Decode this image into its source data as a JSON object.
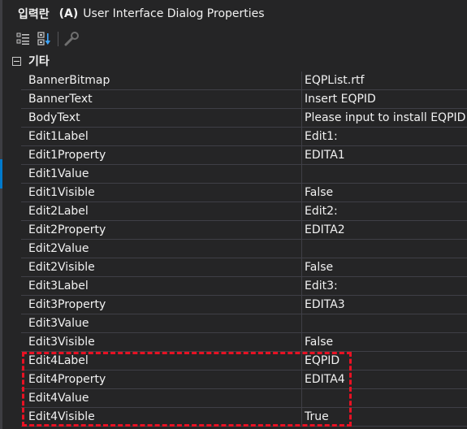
{
  "header": {
    "object_name": "입력란",
    "object_type": "(A)",
    "object_desc": "User Interface Dialog Properties"
  },
  "toolbar": {
    "buttons": [
      {
        "icon": "categorized-icon"
      },
      {
        "icon": "alphabetical-icon"
      },
      {
        "icon": "property-pages-icon"
      }
    ]
  },
  "category": {
    "label": "기타"
  },
  "properties": [
    {
      "name": "BannerBitmap",
      "value": "EQPList.rtf"
    },
    {
      "name": "BannerText",
      "value": "Insert EQPID"
    },
    {
      "name": "BodyText",
      "value": "Please input to install EQPID"
    },
    {
      "name": "Edit1Label",
      "value": "Edit1:"
    },
    {
      "name": "Edit1Property",
      "value": "EDITA1"
    },
    {
      "name": "Edit1Value",
      "value": ""
    },
    {
      "name": "Edit1Visible",
      "value": "False"
    },
    {
      "name": "Edit2Label",
      "value": "Edit2:"
    },
    {
      "name": "Edit2Property",
      "value": "EDITA2"
    },
    {
      "name": "Edit2Value",
      "value": ""
    },
    {
      "name": "Edit2Visible",
      "value": "False"
    },
    {
      "name": "Edit3Label",
      "value": "Edit3:"
    },
    {
      "name": "Edit3Property",
      "value": "EDITA3"
    },
    {
      "name": "Edit3Value",
      "value": ""
    },
    {
      "name": "Edit3Visible",
      "value": "False"
    },
    {
      "name": "Edit4Label",
      "value": "EQPID"
    },
    {
      "name": "Edit4Property",
      "value": "EDITA4"
    },
    {
      "name": "Edit4Value",
      "value": ""
    },
    {
      "name": "Edit4Visible",
      "value": "True"
    }
  ],
  "colors": {
    "background": "#252526",
    "grid_line": "#3f3f46",
    "text": "#f1f1f1",
    "highlight": "#e81123",
    "accent": "#007acc"
  }
}
